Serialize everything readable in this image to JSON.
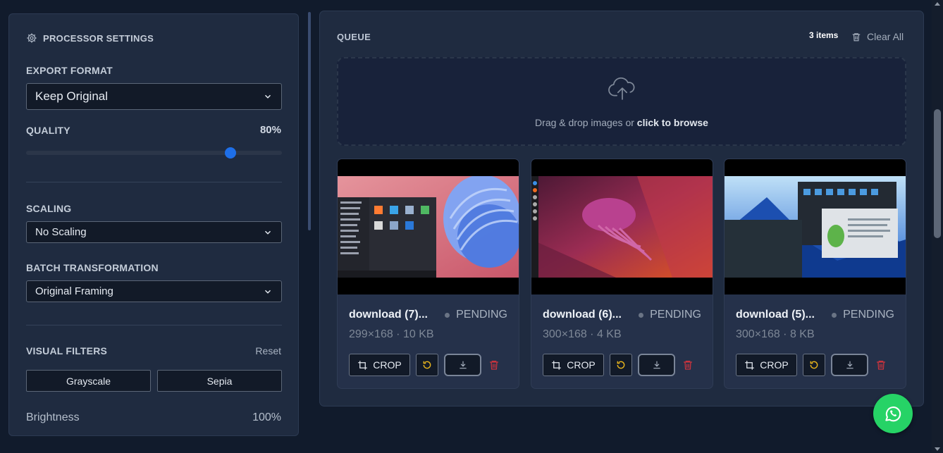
{
  "settings": {
    "title": "PROCESSOR SETTINGS",
    "export_format": {
      "label": "EXPORT FORMAT",
      "value": "Keep Original"
    },
    "quality": {
      "label": "QUALITY",
      "value_text": "80%",
      "value": 0.8
    },
    "scaling": {
      "label": "SCALING",
      "value": "No Scaling"
    },
    "batch": {
      "label": "BATCH TRANSFORMATION",
      "value": "Original Framing"
    },
    "filters": {
      "label": "VISUAL FILTERS",
      "reset": "Reset",
      "grayscale": "Grayscale",
      "sepia": "Sepia"
    },
    "brightness": {
      "label": "Brightness",
      "value": "100%"
    }
  },
  "queue": {
    "title": "QUEUE",
    "count": "3 items",
    "clear": "Clear All",
    "dropzone_prefix": "Drag & drop images or ",
    "dropzone_link": "click to browse",
    "items": [
      {
        "name": "download (7)...",
        "status": "PENDING",
        "meta": "299×168 · 10 KB"
      },
      {
        "name": "download (6)...",
        "status": "PENDING",
        "meta": "300×168 · 4 KB"
      },
      {
        "name": "download (5)...",
        "status": "PENDING",
        "meta": "300×168 · 8 KB"
      }
    ],
    "crop_label": "CROP"
  },
  "icons": {
    "settings": "gear-icon",
    "chevron": "chevron-down-icon",
    "trash": "trash-icon",
    "upload": "cloud-upload-icon",
    "crop": "crop-icon",
    "rotate": "rotate-icon",
    "download": "download-icon",
    "whatsapp": "whatsapp-icon"
  },
  "colors": {
    "accent": "#1e6fe8",
    "rotate": "#e7b41c",
    "delete": "#c9333d",
    "whatsapp": "#26d366"
  }
}
